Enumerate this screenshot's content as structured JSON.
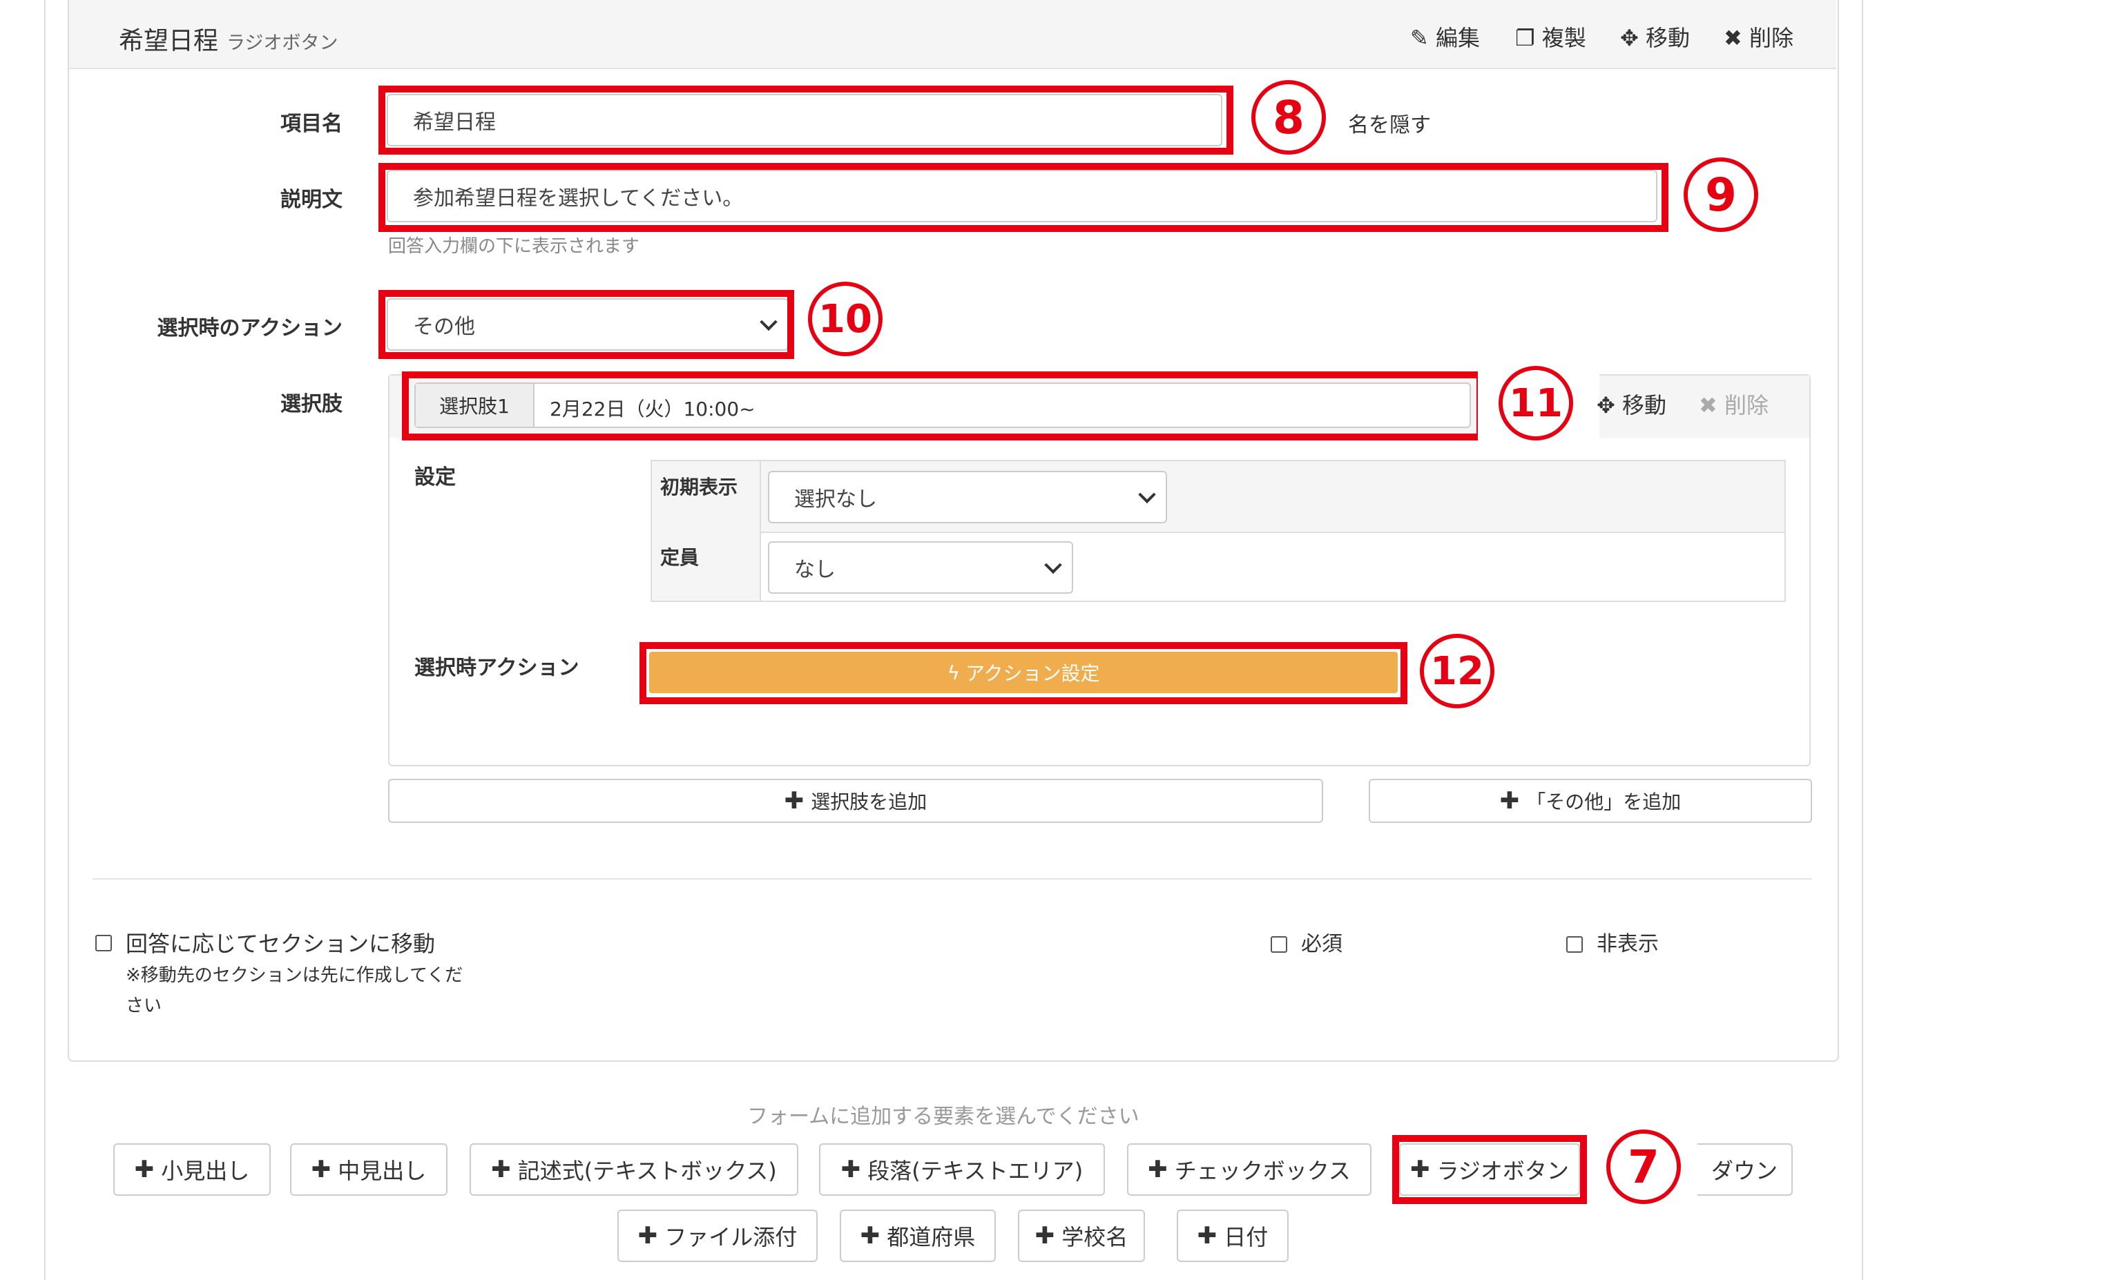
{
  "header": {
    "title": "希望日程",
    "subtitle": "ラジオボタン",
    "tools": {
      "edit": "編集",
      "copy": "複製",
      "move": "移動",
      "delete": "削除"
    }
  },
  "fields": {
    "item_name_label": "項目名",
    "item_name_value": "希望日程",
    "hide_name": "名を隠す",
    "description_label": "説明文",
    "description_value": "参加希望日程を選択してください。",
    "description_help": "回答入力欄の下に表示されます",
    "action_label": "選択時のアクション",
    "action_value": "その他",
    "choices_label": "選択肢"
  },
  "choice": {
    "tag": "選択肢1",
    "value": "2月22日（火）10:00~",
    "move": "移動",
    "delete": "削除",
    "settings_label": "設定",
    "initial_label": "初期表示",
    "initial_value": "選択なし",
    "capacity_label": "定員",
    "capacity_value": "なし",
    "on_select_label": "選択時アクション",
    "action_button": "アクション設定"
  },
  "add_buttons": {
    "add_choice": "選択肢を追加",
    "add_other": "「その他」を追加"
  },
  "options": {
    "section_jump": "回答に応じてセクションに移動",
    "section_note_1": "※移動先のセクションは先に作成してくだ",
    "section_note_2": "さい",
    "required": "必須",
    "hidden": "非表示"
  },
  "palette": {
    "prompt": "フォームに追加する要素を選んでください",
    "row1": [
      "小見出し",
      "中見出し",
      "記述式(テキストボックス)",
      "段落(テキストエリア)",
      "チェックボックス",
      "ラジオボタン",
      "ダウン"
    ],
    "row2": [
      "ファイル添付",
      "都道府県",
      "学校名",
      "日付"
    ]
  },
  "annotations": {
    "n7": "7",
    "n8": "8",
    "n9": "9",
    "n10": "10",
    "n11": "11",
    "n12": "12"
  },
  "colors": {
    "annotation_red": "#e60012",
    "action_orange": "#f0ad4e"
  }
}
